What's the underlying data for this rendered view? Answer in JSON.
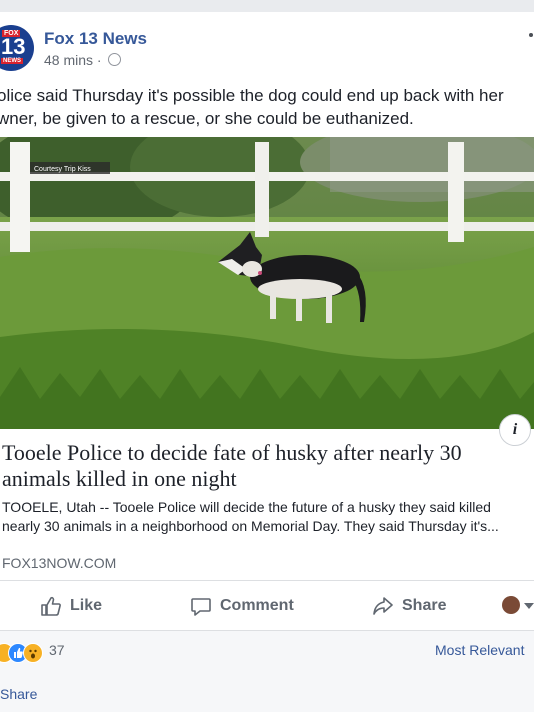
{
  "post": {
    "page_name": "Fox 13 News",
    "timestamp": "48 mins",
    "separator": "·",
    "text_line1": "olice said Thursday it's possible the dog could end up back with her",
    "text_line2": "wner, be given to a rescue, or she could be euthanized."
  },
  "avatar": {
    "fox": "FOX",
    "num": "13",
    "news": "NEWS"
  },
  "link": {
    "image_credit": "Courtesy Trip Kiss",
    "headline": "Tooele Police to decide fate of husky after nearly 30 animals killed in one night",
    "description_line1": "TOOELE, Utah -- Tooele Police will decide the future of a husky they said killed",
    "description_line2": "nearly 30 animals in a neighborhood on Memorial Day. They said Thursday it's...",
    "domain": "FOX13NOW.COM",
    "info_label": "i"
  },
  "actions": {
    "like": "Like",
    "comment": "Comment",
    "share": "Share"
  },
  "footer": {
    "reaction_count": "37",
    "sort_label": "Most Relevant",
    "share_link": "Share"
  },
  "colors": {
    "link_blue": "#365899",
    "gray_text": "#606770",
    "like_blue": "#2d88ff",
    "wow_yellow": "#f7b125"
  }
}
